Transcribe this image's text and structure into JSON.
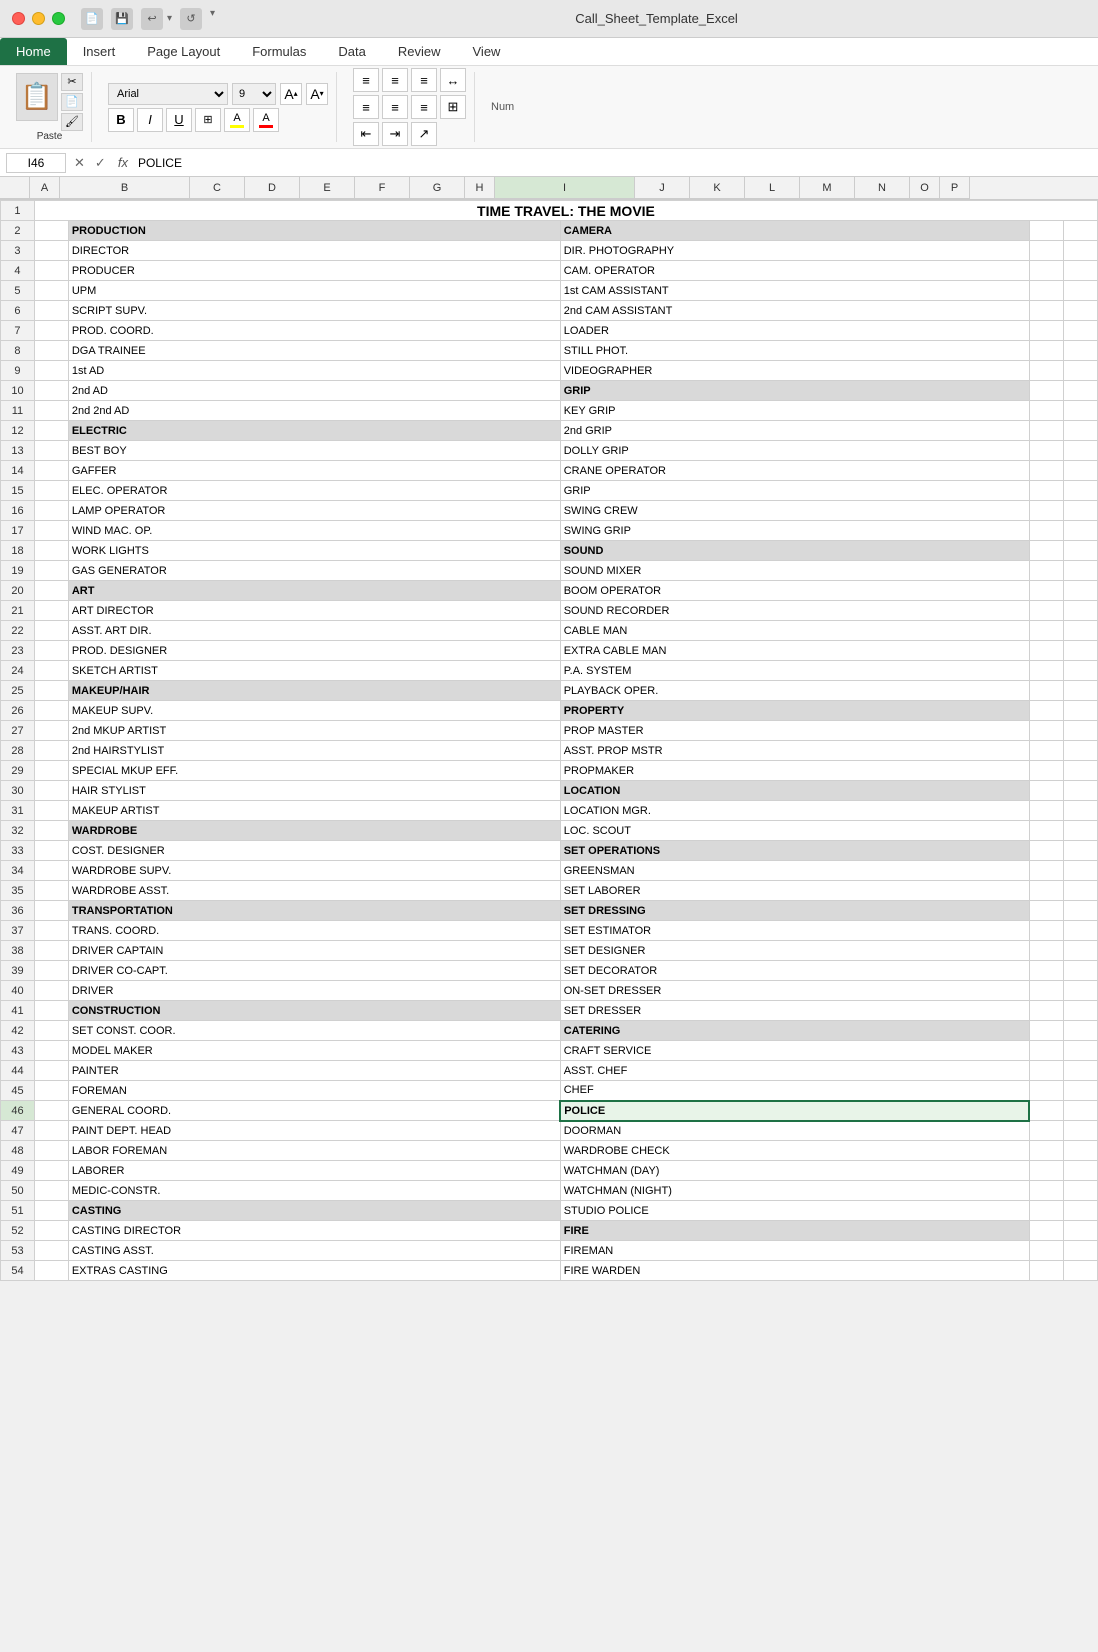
{
  "titlebar": {
    "filename": "Call_Sheet_Template_Excel"
  },
  "ribbon": {
    "tabs": [
      "Home",
      "Insert",
      "Page Layout",
      "Formulas",
      "Data",
      "Review",
      "View"
    ],
    "active_tab": "Home"
  },
  "formula_bar": {
    "cell_ref": "I46",
    "formula": "POLICE"
  },
  "columns": [
    "A",
    "B",
    "C",
    "D",
    "E",
    "F",
    "G",
    "H",
    "I",
    "J",
    "K",
    "L",
    "M",
    "N",
    "O",
    "P"
  ],
  "spreadsheet": {
    "title": "TIME TRAVEL: THE MOVIE",
    "rows": [
      {
        "row": 1,
        "left": {
          "text": "TIME TRAVEL: THE MOVIE",
          "span": 8,
          "style": "title"
        },
        "right": {
          "text": "",
          "span": 8
        }
      },
      {
        "row": 2,
        "left": {
          "text": "PRODUCTION",
          "style": "section-header"
        },
        "right": {
          "text": "CAMERA",
          "style": "section-header"
        }
      },
      {
        "row": 3,
        "left": {
          "text": "DIRECTOR"
        },
        "right": {
          "text": "DIR. PHOTOGRAPHY"
        }
      },
      {
        "row": 4,
        "left": {
          "text": "PRODUCER"
        },
        "right": {
          "text": "CAM. OPERATOR"
        }
      },
      {
        "row": 5,
        "left": {
          "text": "UPM"
        },
        "right": {
          "text": "1st CAM ASSISTANT"
        }
      },
      {
        "row": 6,
        "left": {
          "text": "SCRIPT SUPV."
        },
        "right": {
          "text": "2nd CAM ASSISTANT"
        }
      },
      {
        "row": 7,
        "left": {
          "text": "PROD. COORD."
        },
        "right": {
          "text": "LOADER"
        }
      },
      {
        "row": 8,
        "left": {
          "text": "DGA TRAINEE"
        },
        "right": {
          "text": "STILL PHOT."
        }
      },
      {
        "row": 9,
        "left": {
          "text": "1st AD"
        },
        "right": {
          "text": "VIDEOGRAPHER"
        }
      },
      {
        "row": 10,
        "left": {
          "text": "2nd AD"
        },
        "right": {
          "text": "GRIP",
          "style": "section-header"
        }
      },
      {
        "row": 11,
        "left": {
          "text": "2nd 2nd AD"
        },
        "right": {
          "text": "KEY GRIP"
        }
      },
      {
        "row": 12,
        "left": {
          "text": "ELECTRIC",
          "style": "section-header"
        },
        "right": {
          "text": "2nd GRIP"
        }
      },
      {
        "row": 13,
        "left": {
          "text": "BEST BOY"
        },
        "right": {
          "text": "DOLLY GRIP"
        }
      },
      {
        "row": 14,
        "left": {
          "text": "GAFFER"
        },
        "right": {
          "text": "CRANE OPERATOR"
        }
      },
      {
        "row": 15,
        "left": {
          "text": "ELEC. OPERATOR"
        },
        "right": {
          "text": "GRIP"
        }
      },
      {
        "row": 16,
        "left": {
          "text": "LAMP OPERATOR"
        },
        "right": {
          "text": "SWING CREW"
        }
      },
      {
        "row": 17,
        "left": {
          "text": "WIND MAC. OP."
        },
        "right": {
          "text": "SWING GRIP"
        }
      },
      {
        "row": 18,
        "left": {
          "text": "WORK LIGHTS"
        },
        "right": {
          "text": "SOUND",
          "style": "section-header"
        }
      },
      {
        "row": 19,
        "left": {
          "text": "GAS GENERATOR"
        },
        "right": {
          "text": "SOUND MIXER"
        }
      },
      {
        "row": 20,
        "left": {
          "text": "ART",
          "style": "section-header"
        },
        "right": {
          "text": "BOOM OPERATOR"
        }
      },
      {
        "row": 21,
        "left": {
          "text": "ART DIRECTOR"
        },
        "right": {
          "text": "SOUND RECORDER"
        }
      },
      {
        "row": 22,
        "left": {
          "text": "ASST. ART DIR."
        },
        "right": {
          "text": "CABLE MAN"
        }
      },
      {
        "row": 23,
        "left": {
          "text": "PROD. DESIGNER"
        },
        "right": {
          "text": "EXTRA CABLE MAN"
        }
      },
      {
        "row": 24,
        "left": {
          "text": "SKETCH ARTIST"
        },
        "right": {
          "text": "P.A. SYSTEM"
        }
      },
      {
        "row": 25,
        "left": {
          "text": "MAKEUP/HAIR",
          "style": "section-header"
        },
        "right": {
          "text": "PLAYBACK OPER."
        }
      },
      {
        "row": 26,
        "left": {
          "text": "MAKEUP SUPV."
        },
        "right": {
          "text": "PROPERTY",
          "style": "section-header"
        }
      },
      {
        "row": 27,
        "left": {
          "text": "2nd MKUP ARTIST"
        },
        "right": {
          "text": "PROP MASTER"
        }
      },
      {
        "row": 28,
        "left": {
          "text": "2nd HAIRSTYLIST"
        },
        "right": {
          "text": "ASST. PROP MSTR"
        }
      },
      {
        "row": 29,
        "left": {
          "text": "SPECIAL MKUP EFF."
        },
        "right": {
          "text": "PROPMAKER"
        }
      },
      {
        "row": 30,
        "left": {
          "text": "HAIR STYLIST"
        },
        "right": {
          "text": "LOCATION",
          "style": "section-header"
        }
      },
      {
        "row": 31,
        "left": {
          "text": "MAKEUP ARTIST"
        },
        "right": {
          "text": "LOCATION MGR."
        }
      },
      {
        "row": 32,
        "left": {
          "text": "WARDROBE",
          "style": "section-header"
        },
        "right": {
          "text": "LOC. SCOUT"
        }
      },
      {
        "row": 33,
        "left": {
          "text": "COST. DESIGNER"
        },
        "right": {
          "text": "SET OPERATIONS",
          "style": "section-header"
        }
      },
      {
        "row": 34,
        "left": {
          "text": "WARDROBE SUPV."
        },
        "right": {
          "text": "GREENSMAN"
        }
      },
      {
        "row": 35,
        "left": {
          "text": "WARDROBE ASST."
        },
        "right": {
          "text": "SET LABORER"
        }
      },
      {
        "row": 36,
        "left": {
          "text": "TRANSPORTATION",
          "style": "section-header"
        },
        "right": {
          "text": "SET DRESSING",
          "style": "section-header"
        }
      },
      {
        "row": 37,
        "left": {
          "text": "TRANS. COORD."
        },
        "right": {
          "text": "SET ESTIMATOR"
        }
      },
      {
        "row": 38,
        "left": {
          "text": "DRIVER CAPTAIN"
        },
        "right": {
          "text": "SET DESIGNER"
        }
      },
      {
        "row": 39,
        "left": {
          "text": "DRIVER CO-CAPT."
        },
        "right": {
          "text": "SET DECORATOR"
        }
      },
      {
        "row": 40,
        "left": {
          "text": "DRIVER"
        },
        "right": {
          "text": "ON-SET DRESSER"
        }
      },
      {
        "row": 41,
        "left": {
          "text": "CONSTRUCTION",
          "style": "section-header"
        },
        "right": {
          "text": "SET DRESSER"
        }
      },
      {
        "row": 42,
        "left": {
          "text": "SET CONST. COOR."
        },
        "right": {
          "text": "CATERING",
          "style": "section-header"
        }
      },
      {
        "row": 43,
        "left": {
          "text": "MODEL MAKER"
        },
        "right": {
          "text": "CRAFT SERVICE"
        }
      },
      {
        "row": 44,
        "left": {
          "text": "PAINTER"
        },
        "right": {
          "text": "ASST. CHEF"
        }
      },
      {
        "row": 45,
        "left": {
          "text": "FOREMAN"
        },
        "right": {
          "text": "CHEF"
        }
      },
      {
        "row": 46,
        "left": {
          "text": "GENERAL COORD."
        },
        "right": {
          "text": "POLICE",
          "style": "section-header",
          "selected": true
        }
      },
      {
        "row": 47,
        "left": {
          "text": "PAINT DEPT. HEAD"
        },
        "right": {
          "text": "DOORMAN"
        }
      },
      {
        "row": 48,
        "left": {
          "text": "LABOR FOREMAN"
        },
        "right": {
          "text": "WARDROBE CHECK"
        }
      },
      {
        "row": 49,
        "left": {
          "text": "LABORER"
        },
        "right": {
          "text": "WATCHMAN (DAY)"
        }
      },
      {
        "row": 50,
        "left": {
          "text": "MEDIC-CONSTR."
        },
        "right": {
          "text": "WATCHMAN (NIGHT)"
        }
      },
      {
        "row": 51,
        "left": {
          "text": "CASTING",
          "style": "section-header"
        },
        "right": {
          "text": "STUDIO POLICE"
        }
      },
      {
        "row": 52,
        "left": {
          "text": "CASTING DIRECTOR"
        },
        "right": {
          "text": "FIRE",
          "style": "section-header"
        }
      },
      {
        "row": 53,
        "left": {
          "text": "CASTING ASST."
        },
        "right": {
          "text": "FIREMAN"
        }
      },
      {
        "row": 54,
        "left": {
          "text": "EXTRAS CASTING"
        },
        "right": {
          "text": "FIRE WARDEN"
        }
      }
    ]
  },
  "toolbar": {
    "paste_label": "Paste",
    "font_name": "Arial",
    "font_size": "9",
    "bold": "B",
    "italic": "I",
    "underline": "U",
    "number_label": "Num"
  }
}
